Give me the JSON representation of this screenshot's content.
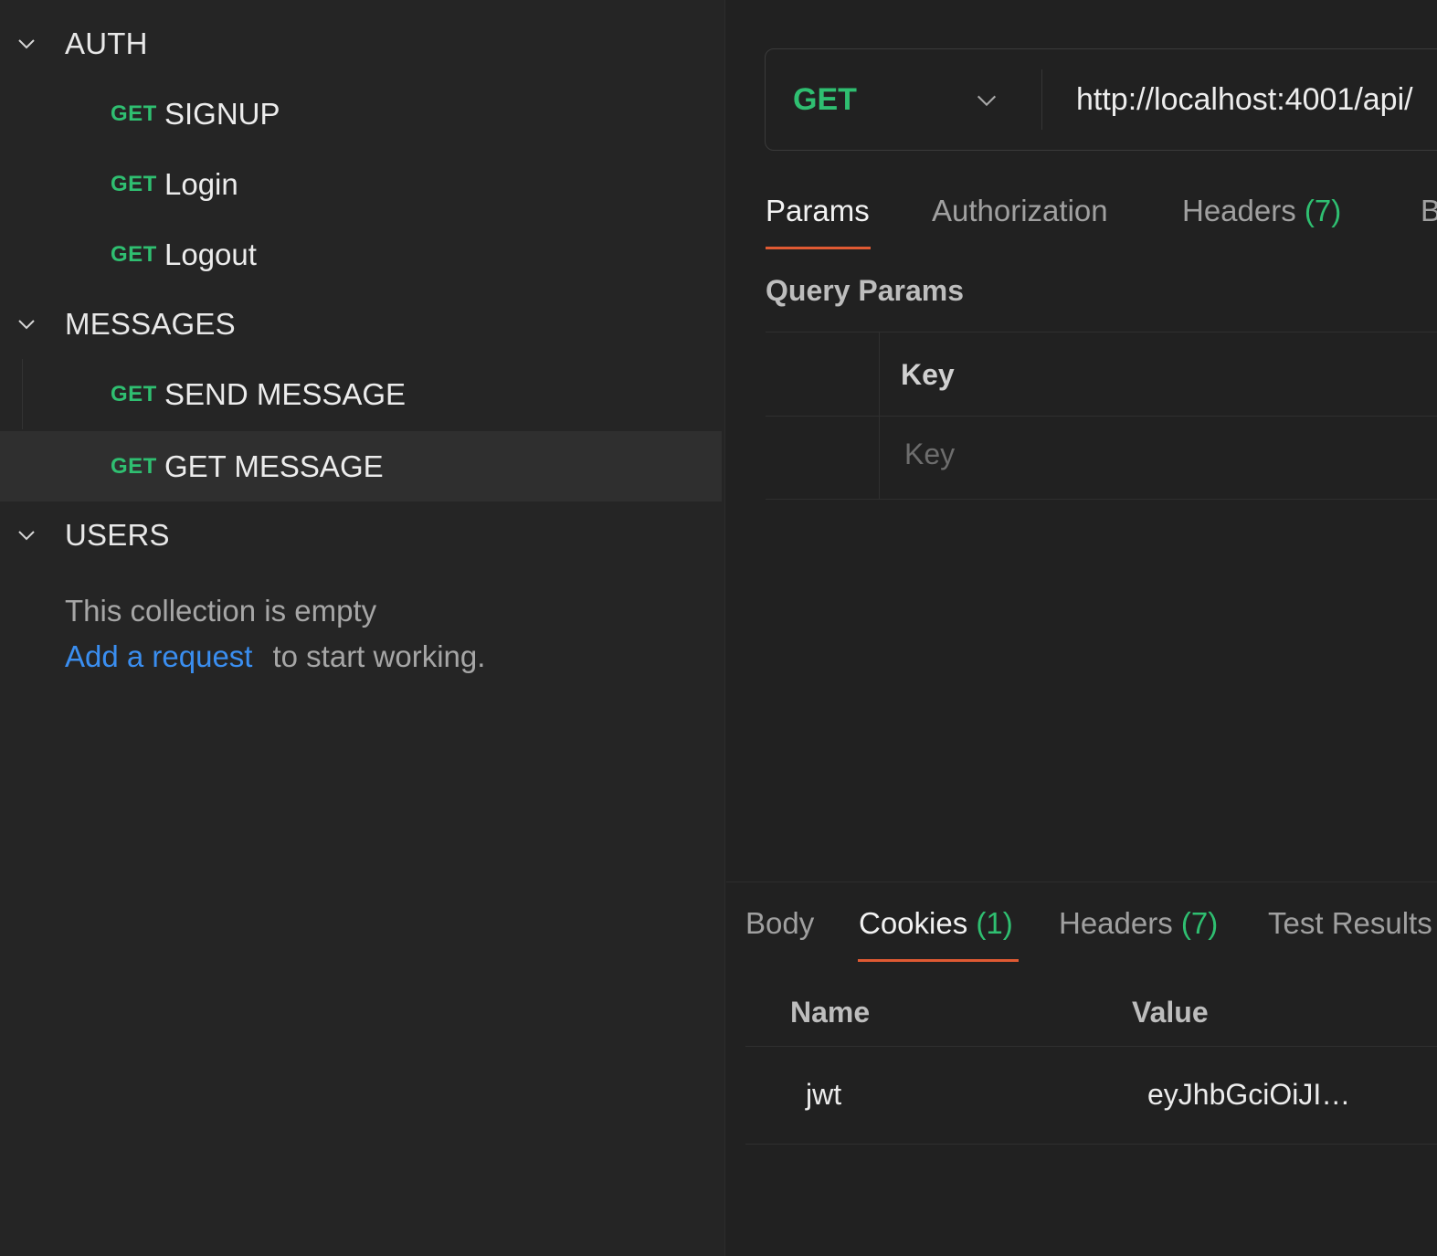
{
  "sidebar": {
    "folders": [
      {
        "label": "AUTH"
      },
      {
        "label": "MESSAGES"
      },
      {
        "label": "USERS"
      }
    ],
    "auth_requests": [
      {
        "method": "GET",
        "name": "SIGNUP"
      },
      {
        "method": "GET",
        "name": "Login"
      },
      {
        "method": "GET",
        "name": "Logout"
      }
    ],
    "message_requests": [
      {
        "method": "GET",
        "name": "SEND MESSAGE"
      },
      {
        "method": "GET",
        "name": "GET MESSAGE"
      }
    ],
    "users_empty": {
      "text": "This collection is empty",
      "link": "Add a request",
      "suffix": "to start working."
    }
  },
  "request": {
    "method": "GET",
    "url": "http://localhost:4001/api/",
    "tabs": [
      {
        "label": "Params"
      },
      {
        "label": "Authorization"
      },
      {
        "label": "Headers",
        "count": "(7)"
      },
      {
        "label": "B"
      }
    ],
    "query_params_title": "Query Params",
    "params_table": {
      "key_header": "Key",
      "key_placeholder": "Key"
    }
  },
  "response": {
    "tabs": [
      {
        "label": "Body"
      },
      {
        "label": "Cookies",
        "count": "(1)"
      },
      {
        "label": "Headers",
        "count": "(7)"
      },
      {
        "label": "Test Results"
      }
    ],
    "cookies_table": {
      "headers": [
        "Name",
        "Value"
      ],
      "rows": [
        {
          "name": "jwt",
          "value": "eyJhbGciOiJI…"
        }
      ]
    }
  },
  "colors": {
    "method_get": "#2fbf71",
    "active_tab_underline": "#e05a33",
    "link": "#3a8ef0",
    "background": "#212121",
    "sidebar_background": "#252525"
  }
}
